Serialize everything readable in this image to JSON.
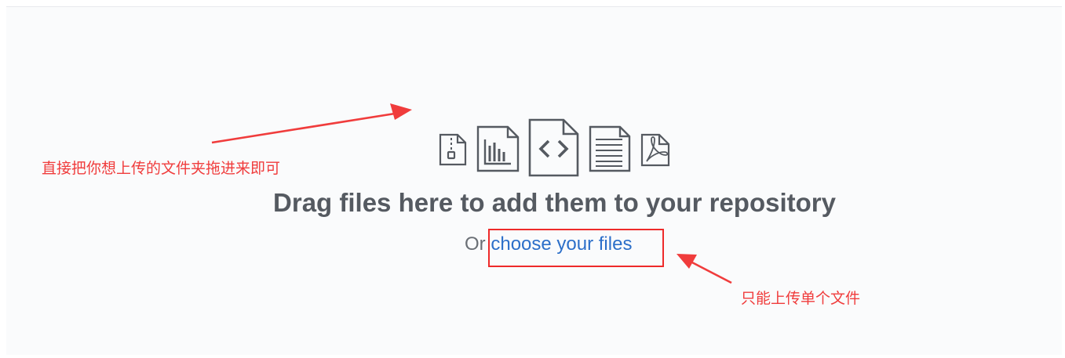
{
  "dropzone": {
    "headline": "Drag files here to add them to your repository",
    "prefix": "Or",
    "link_label": "choose your files",
    "file_icons": [
      "zip-file-icon",
      "chart-file-icon",
      "code-file-icon",
      "text-file-icon",
      "pdf-file-icon"
    ]
  },
  "annotations": {
    "left_note": "直接把你想上传的文件夹拖进来即可",
    "right_note": "只能上传单个文件",
    "color": "#f03c3c"
  },
  "colors": {
    "link": "#2c6fc9",
    "headline": "#555a61",
    "icon_stroke": "#555a61",
    "highlight": "#ee2a2a"
  }
}
